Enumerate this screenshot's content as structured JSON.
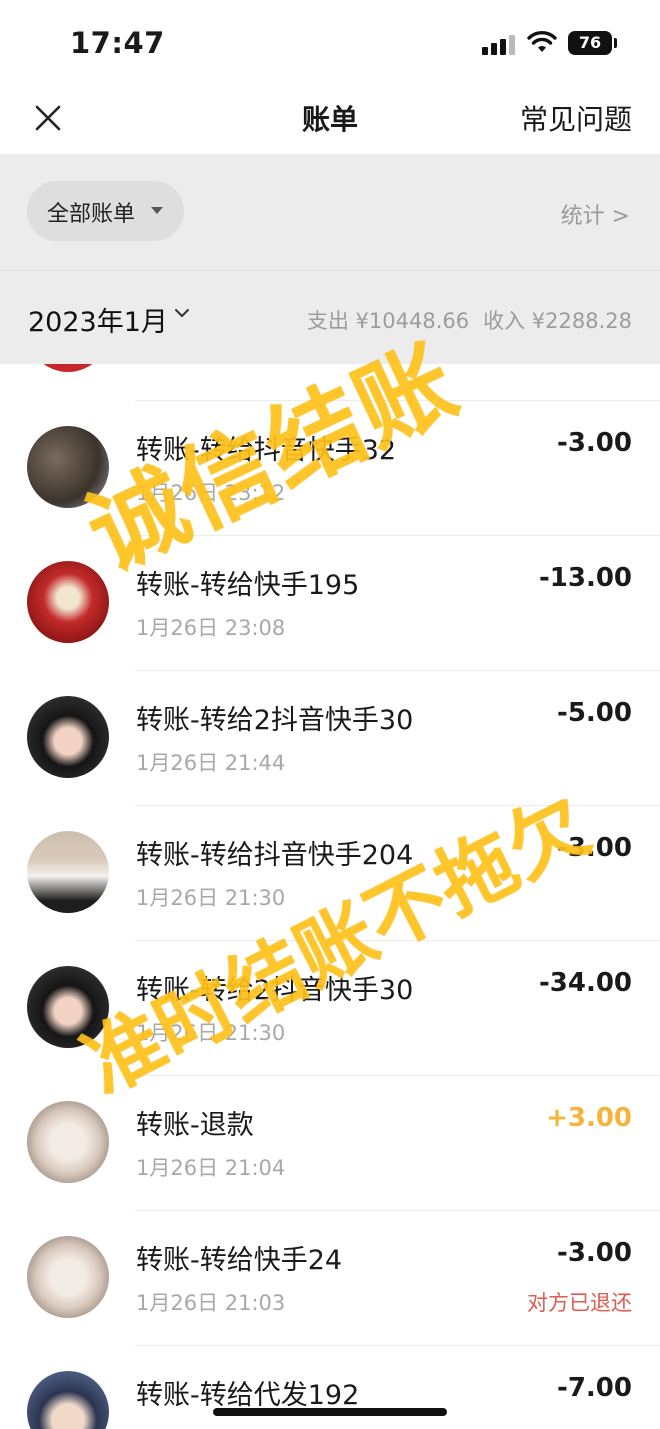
{
  "status_bar": {
    "time": "17:47",
    "battery": "76",
    "icons": [
      "signal-icon",
      "wifi-icon",
      "battery-icon"
    ]
  },
  "nav": {
    "title": "账单",
    "faq_label": "常见问题",
    "close_icon": "close-icon"
  },
  "filter": {
    "pill_label": "全部账单",
    "stats_label": "统计 >"
  },
  "month": {
    "label": "2023年1月",
    "expense": "支出 ¥10448.66",
    "income": "收入 ¥2288.28"
  },
  "transactions": [
    {
      "title": "转账-转给抖音快手32",
      "time": "1月26日 23:12",
      "amount": "-3.00",
      "note": ""
    },
    {
      "title": "转账-转给快手195",
      "time": "1月26日 23:08",
      "amount": "-13.00",
      "note": ""
    },
    {
      "title": "转账-转给2抖音快手30",
      "time": "1月26日 21:44",
      "amount": "-5.00",
      "note": ""
    },
    {
      "title": "转账-转给抖音快手204",
      "time": "1月26日 21:30",
      "amount": "-3.00",
      "note": ""
    },
    {
      "title": "转账-转给2抖音快手30",
      "time": "1月26日 21:30",
      "amount": "-34.00",
      "note": ""
    },
    {
      "title": "转账-退款",
      "time": "1月26日 21:04",
      "amount": "+3.00",
      "note": ""
    },
    {
      "title": "转账-转给快手24",
      "time": "1月26日 21:03",
      "amount": "-3.00",
      "note": "对方已退还"
    },
    {
      "title": "转账-转给代发192",
      "time": "",
      "amount": "-7.00",
      "note": ""
    }
  ],
  "watermarks": {
    "top": "诚信结账",
    "bottom": "准时结账不拖欠"
  },
  "colors": {
    "income": "#f4b33a",
    "refund_note": "#e05a4e",
    "watermark": "#ffc21b"
  }
}
